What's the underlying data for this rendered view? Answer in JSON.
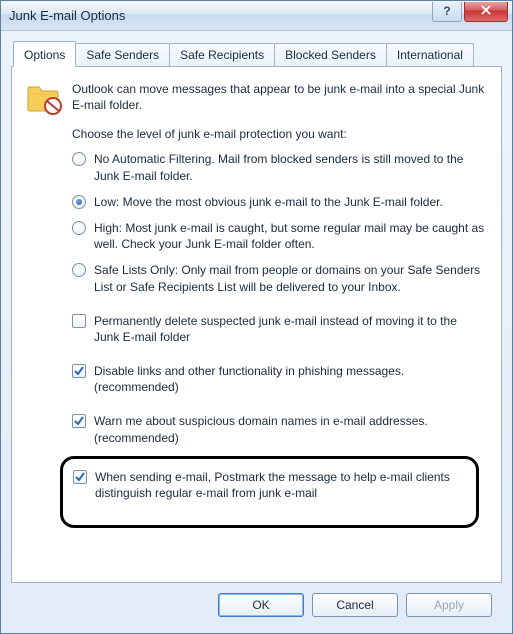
{
  "window": {
    "title": "Junk E-mail Options"
  },
  "tabs": {
    "options": "Options",
    "safe_senders": "Safe Senders",
    "safe_recipients": "Safe Recipients",
    "blocked_senders": "Blocked Senders",
    "international": "International"
  },
  "intro": "Outlook can move messages that appear to be junk e-mail into a special Junk E-mail folder.",
  "choose_level": "Choose the level of junk e-mail protection you want:",
  "radios": {
    "no_auto": "No Automatic Filtering. Mail from blocked senders is still moved to the Junk E-mail folder.",
    "low": "Low: Move the most obvious junk e-mail to the Junk E-mail folder.",
    "high": "High: Most junk e-mail is caught, but some regular mail may be caught as well. Check your Junk E-mail folder often.",
    "safe_lists": "Safe Lists Only: Only mail from people or domains on your Safe Senders List or Safe Recipients List will be delivered to your Inbox."
  },
  "checks": {
    "perm_delete": "Permanently delete suspected junk e-mail instead of moving it to the Junk E-mail folder",
    "disable_links": "Disable links and other functionality in phishing messages. (recommended)",
    "warn_domains": "Warn me about suspicious domain names in e-mail addresses. (recommended)",
    "postmark": "When sending e-mail, Postmark the message to help e-mail clients distinguish regular e-mail from junk e-mail"
  },
  "buttons": {
    "ok": "OK",
    "cancel": "Cancel",
    "apply": "Apply"
  }
}
